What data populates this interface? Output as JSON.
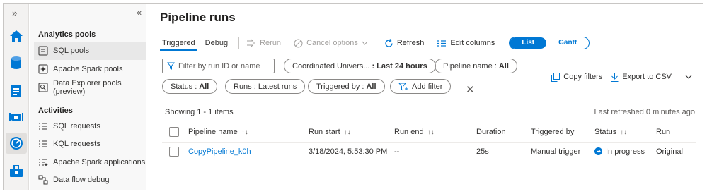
{
  "rail": {
    "collapse_glyph": "»",
    "icons": [
      "home-icon",
      "database-icon",
      "document-icon",
      "pipeline-icon",
      "monitor-icon",
      "toolbox-icon"
    ],
    "active_index": 4
  },
  "nav": {
    "collapse_glyph": "«",
    "section_pools": "Analytics pools",
    "pools": [
      {
        "label": "SQL pools",
        "icon": "sql-pool-icon",
        "selected": true
      },
      {
        "label": "Apache Spark pools",
        "icon": "spark-pool-icon",
        "selected": false
      },
      {
        "label": "Data Explorer pools (preview)",
        "icon": "data-explorer-icon",
        "selected": false
      }
    ],
    "section_activities": "Activities",
    "activities": [
      {
        "label": "SQL requests",
        "icon": "list-icon"
      },
      {
        "label": "KQL requests",
        "icon": "list-icon"
      },
      {
        "label": "Apache Spark applications",
        "icon": "list-star-icon"
      },
      {
        "label": "Data flow debug",
        "icon": "dataflow-icon"
      }
    ]
  },
  "page": {
    "title": "Pipeline runs"
  },
  "toolbar": {
    "tab_triggered": "Triggered",
    "tab_debug": "Debug",
    "rerun": "Rerun",
    "cancel_options": "Cancel options",
    "refresh": "Refresh",
    "edit_columns": "Edit columns",
    "view_list": "List",
    "view_gantt": "Gantt"
  },
  "filters": {
    "search_placeholder": "Filter by run ID or name",
    "time_zone_label": "Coordinated Univers...",
    "time_zone_value": ": Last 24 hours",
    "pipeline_label": "Pipeline name : ",
    "pipeline_value": "All",
    "status_label": "Status : ",
    "status_value": "All",
    "runs_label": "Runs : Latest runs",
    "triggered_label": "Triggered by : ",
    "triggered_value": "All",
    "add_filter": "Add filter"
  },
  "actions": {
    "copy_filters": "Copy filters",
    "export_csv": "Export to CSV"
  },
  "summary": {
    "showing": "Showing 1 - 1 items",
    "refreshed": "Last refreshed 0 minutes ago"
  },
  "table": {
    "columns": {
      "pipeline_name": "Pipeline name",
      "run_start": "Run start",
      "run_end": "Run end",
      "duration": "Duration",
      "triggered_by": "Triggered by",
      "status": "Status",
      "run": "Run"
    },
    "rows": [
      {
        "pipeline_name": "CopyPipeline_k0h",
        "run_start": "3/18/2024, 5:53:30 PM",
        "run_end": "--",
        "duration": "25s",
        "triggered_by": "Manual trigger",
        "status": "In progress",
        "run": "Original"
      }
    ]
  },
  "colors": {
    "accent": "#0078d4",
    "rail_bg": "#f3f2f1",
    "nav_bg": "#f8f8f8"
  }
}
